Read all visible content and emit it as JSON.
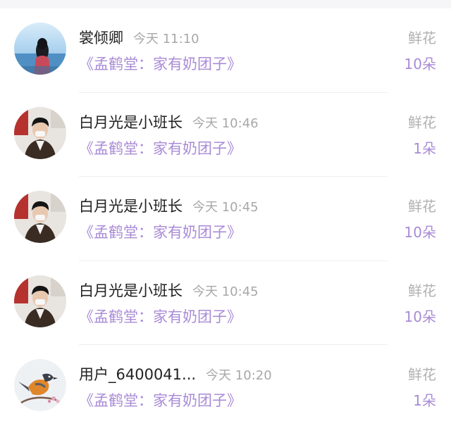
{
  "messages": [
    {
      "name": "裳倾卿",
      "time": "今天 11:10",
      "book": "《孟鹤堂：家有奶团子》",
      "gift": "鲜花",
      "count": "10朵",
      "avatar_icon": "woman-lake-avatar-icon"
    },
    {
      "name": "白月光是小班长",
      "time": "今天 10:46",
      "book": "《孟鹤堂：家有奶团子》",
      "gift": "鲜花",
      "count": "1朵",
      "avatar_icon": "man-masked-avatar-icon"
    },
    {
      "name": "白月光是小班长",
      "time": "今天 10:45",
      "book": "《孟鹤堂：家有奶团子》",
      "gift": "鲜花",
      "count": "10朵",
      "avatar_icon": "man-masked-avatar-icon"
    },
    {
      "name": "白月光是小班长",
      "time": "今天 10:45",
      "book": "《孟鹤堂：家有奶团子》",
      "gift": "鲜花",
      "count": "10朵",
      "avatar_icon": "man-masked-avatar-icon"
    },
    {
      "name": "用户_6400041...",
      "time": "今天 10:20",
      "book": "《孟鹤堂：家有奶团子》",
      "gift": "鲜花",
      "count": "1朵",
      "avatar_icon": "bird-branch-avatar-icon"
    }
  ],
  "colors": {
    "accent": "#a98bd6",
    "muted": "#a8a8a8",
    "name": "#222222"
  }
}
